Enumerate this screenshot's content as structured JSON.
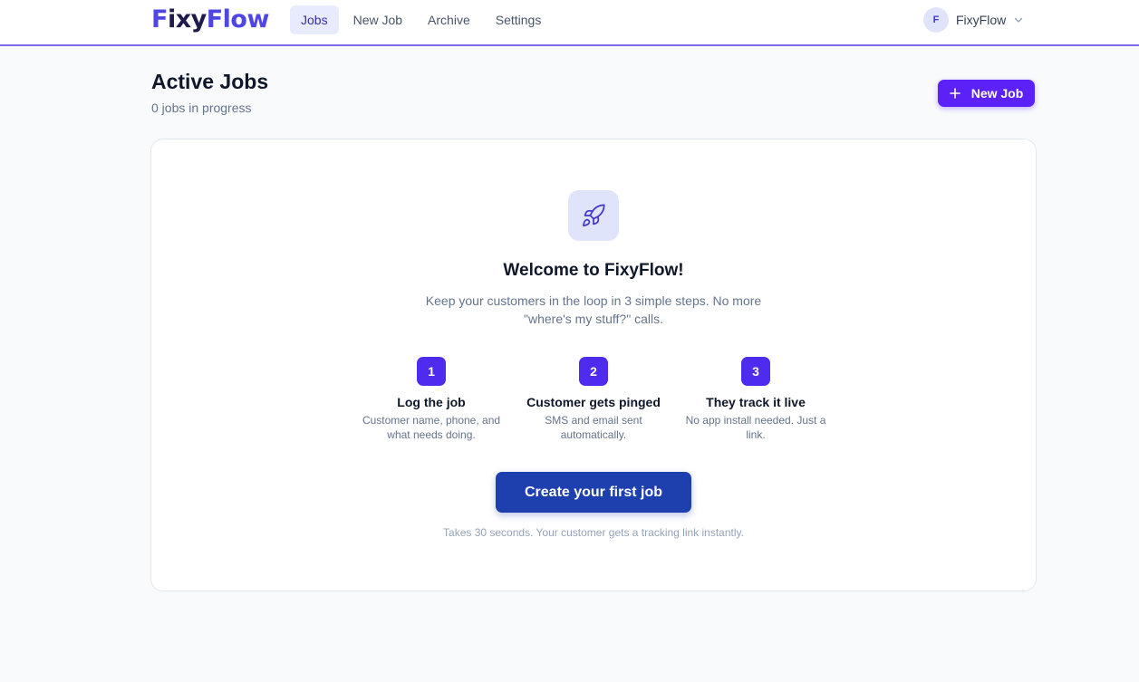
{
  "header": {
    "logo": {
      "first_letter": "F",
      "part1": "ixy",
      "part2": "Flow"
    },
    "nav": [
      {
        "label": "Jobs",
        "active": true
      },
      {
        "label": "New Job",
        "active": false
      },
      {
        "label": "Archive",
        "active": false
      },
      {
        "label": "Settings",
        "active": false
      }
    ],
    "account": {
      "initial": "F",
      "name": "FixyFlow"
    }
  },
  "page": {
    "title": "Active Jobs",
    "subtitle": "0 jobs in progress",
    "new_job_label": "New Job"
  },
  "empty_state": {
    "icon": "rocket-icon",
    "heading": "Welcome to FixyFlow!",
    "intro": "Keep your customers in the loop in 3 simple steps. No more \"where's my stuff?\" calls.",
    "steps": [
      {
        "number": "1",
        "title": "Log the job",
        "desc": "Customer name, phone, and what needs doing."
      },
      {
        "number": "2",
        "title": "Customer gets pinged",
        "desc": "SMS and email sent automatically."
      },
      {
        "number": "3",
        "title": "They track it live",
        "desc": "No app install needed. Just a link."
      }
    ],
    "cta_label": "Create your first job",
    "footnote": "Takes 30 seconds. Your customer gets a tracking link instantly."
  },
  "colors": {
    "accent": "#4f46e5",
    "button_purple": "#5b21f6",
    "cta_blue": "#1e3fae",
    "header_border": "#7c6cf0"
  }
}
